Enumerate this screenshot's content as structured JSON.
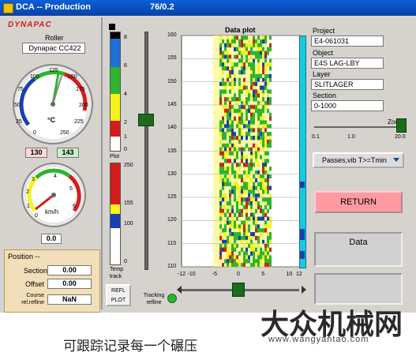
{
  "window": {
    "title": "DCA -- Production",
    "counter": "76/0.2"
  },
  "brand": {
    "logo": "DYNAPAC"
  },
  "roller": {
    "label": "Roller",
    "model": "Dynapac CC422"
  },
  "temp_gauge": {
    "ticks": [
      "0",
      "25",
      "50",
      "75",
      "100",
      "125",
      "150",
      "175",
      "200",
      "225",
      "250"
    ],
    "unit": "°C",
    "value_low": "130",
    "value_high": "143"
  },
  "speed_gauge": {
    "ticks": [
      "0",
      "1",
      "2",
      "3",
      "4",
      "5",
      "6"
    ],
    "unit": "km/h",
    "value": "0.0"
  },
  "position": {
    "title": "Position --",
    "section_label": "Section",
    "section_value": "0.00",
    "offset_label": "Offset",
    "offset_value": "0.00",
    "course_label": "Course rel.refline",
    "course_value": "NaN"
  },
  "plot_scale": {
    "ticks": [
      "8",
      "6",
      "4",
      "2",
      "1",
      "0"
    ],
    "label": "Plot"
  },
  "temp_scale": {
    "ticks": [
      "250",
      "155",
      "100",
      "0"
    ],
    "label": "Temp track"
  },
  "buttons": {
    "refl_plot": "REFL PLOT",
    "tracking": "Tracking refline",
    "return": "RETURN",
    "data": "Data"
  },
  "data_plot": {
    "title": "Data plot",
    "y_ticks": [
      "160",
      "155",
      "150",
      "145",
      "140",
      "135",
      "130",
      "125",
      "120",
      "115",
      "110"
    ],
    "x_ticks": [
      "-12",
      "-10",
      "-5",
      "0",
      "5",
      "10",
      "12"
    ]
  },
  "project": {
    "project_label": "Project",
    "project_value": "E4-061031",
    "object_label": "Object",
    "object_value": "E4S LAG-LBY",
    "layer_label": "Layer",
    "layer_value": "SLITLAGER",
    "section_label": "Section",
    "section_value": "0-1000"
  },
  "zoom": {
    "label": "Zoom",
    "ticks": [
      "0.1",
      "1.0",
      "20.0"
    ]
  },
  "dropdown": {
    "selected": "Passes,vib T>=Tmin"
  },
  "caption": "可跟踪记录每一个碾压",
  "watermark": {
    "title": "大众机械网",
    "url": "www.wangyantao.com"
  },
  "colors": {
    "accent_blue": "#0a5fd7",
    "return_bg": "#ff9aa0",
    "green": "#2db52d",
    "yellow": "#f5f31a",
    "red": "#cc2222",
    "cyan": "#1ac8e0"
  }
}
